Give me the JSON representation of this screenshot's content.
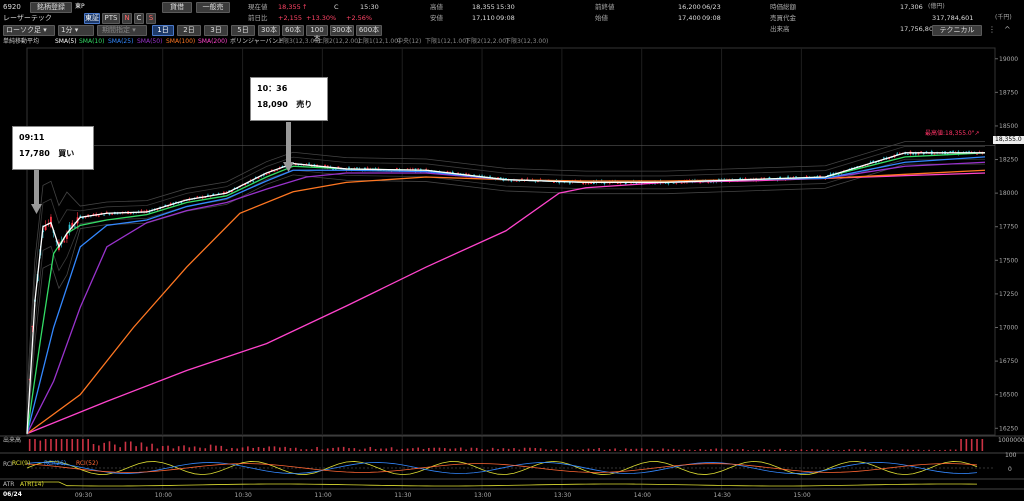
{
  "header": {
    "code": "6920",
    "name": "レーザーテック",
    "btn_stock_list": "銘柄登録",
    "tag_exchange": "東P",
    "tag_tse": "東証",
    "tag_pts": "PTS",
    "tag_n": "N",
    "tag_c": "C",
    "tag_s": "S",
    "btn_credit": "貸借",
    "btn_general": "一般売",
    "chart_type": "ローソク足",
    "interval": "1分",
    "period_label": "期間指定",
    "ranges": [
      "1日",
      "2日",
      "3日",
      "5日",
      "30本",
      "60本",
      "100本",
      "300本",
      "600本"
    ],
    "active_range": 0,
    "technical_btn": "テクニカル",
    "quote": {
      "price_label": "現在値",
      "price": "18,355",
      "price_mark": "↑",
      "c": "C",
      "time": "15:30",
      "change_label": "前日比",
      "change": "+2,155",
      "change_pct": "+13.30%",
      "change_pct2": "+2.56%",
      "high_label": "高値",
      "high": "18,355",
      "high_time": "15:30",
      "low_label": "安値",
      "low": "17,110",
      "low_time": "09:08",
      "prev_label": "前終値",
      "prev": "16,200",
      "prev_date": "06/23",
      "open_label": "始値",
      "open": "17,400",
      "open_time": "09:08",
      "mcap_label": "時価総額",
      "mcap": "17,306",
      "mcap_unit": "(億円)",
      "turnover_label": "売買代金",
      "turnover": "317,784,601",
      "turnover_unit": "(千円)",
      "volume_label": "出来高",
      "volume": "17,756,800"
    },
    "legend": [
      {
        "text": "単純移動平均",
        "color": "#cccccc"
      },
      {
        "text": "SMA(5)",
        "color": "#ffffff"
      },
      {
        "text": "SMA(10)",
        "color": "#33dd66"
      },
      {
        "text": "SMA(25)",
        "color": "#3388ff"
      },
      {
        "text": "SMA(50)",
        "color": "#9933cc"
      },
      {
        "text": "SMA(100)",
        "color": "#ff7722"
      },
      {
        "text": "SMA(200)",
        "color": "#ff44cc"
      },
      {
        "text": "ボリンジャーバンド",
        "color": "#cccccc"
      },
      {
        "text": "上限3(12,3.00)",
        "color": "#888888"
      },
      {
        "text": "上限2(12,2.00)",
        "color": "#888888"
      },
      {
        "text": "上限1(12,1.00)",
        "color": "#888888"
      },
      {
        "text": "中央(12)",
        "color": "#888888"
      },
      {
        "text": "下限1(12,1.00)",
        "color": "#888888"
      },
      {
        "text": "下限2(12,2.00)",
        "color": "#888888"
      },
      {
        "text": "下限3(12,3.00)",
        "color": "#888888"
      }
    ]
  },
  "callouts": {
    "buy": {
      "time": "09:11",
      "price": "17,780",
      "action": "買い"
    },
    "sell": {
      "time": "10：36",
      "price": "18,090",
      "action": "売り"
    }
  },
  "annotations": {
    "high_label": "最高値:18,355.0\"↗",
    "last_price": "18,355.0"
  },
  "volume_panel": {
    "label": "出来高",
    "scale": "1000000"
  },
  "rci_panel": {
    "label": "RCI",
    "legend": [
      "RCI(9)",
      "RCI(26)",
      "RCI(52)"
    ],
    "colors": [
      "#dddd33",
      "#3388ff",
      "#ff6633"
    ],
    "scale_top": "100",
    "scale_mid": "0"
  },
  "atr_panel": {
    "label": "ATR",
    "legend": "ATR(14)",
    "color": "#dddd33"
  },
  "chart_data": {
    "type": "line",
    "y_ticks": [
      19000,
      18750,
      18500,
      18250,
      18000,
      17750,
      17500,
      17250,
      17000,
      16750,
      16500,
      16250
    ],
    "ylim": [
      16200,
      19080
    ],
    "x_date": "06/24",
    "x_ticks": [
      "09:30",
      "10:00",
      "10:30",
      "11:00",
      "11:30",
      "13:00",
      "13:30",
      "14:00",
      "14:30",
      "15:00"
    ],
    "series": [
      {
        "name": "SMA(5)",
        "color": "#ffffff",
        "x": [
          0,
          3,
          6,
          9,
          12,
          15,
          20,
          30,
          45,
          60,
          75,
          90,
          100,
          120,
          150,
          180,
          210,
          240,
          270,
          300,
          330,
          360
        ],
        "y": [
          16210,
          17200,
          17750,
          17780,
          17600,
          17700,
          17820,
          17850,
          17860,
          17950,
          18000,
          18150,
          18220,
          18180,
          18170,
          18100,
          18080,
          18080,
          18100,
          18120,
          18300,
          18300
        ]
      },
      {
        "name": "SMA(10)",
        "color": "#33dd66",
        "x": [
          0,
          5,
          10,
          15,
          20,
          30,
          45,
          60,
          75,
          90,
          100,
          120,
          150,
          180,
          210,
          240,
          270,
          300,
          330,
          360
        ],
        "y": [
          16210,
          16900,
          17550,
          17700,
          17760,
          17800,
          17840,
          17930,
          17980,
          18120,
          18200,
          18180,
          18170,
          18100,
          18080,
          18080,
          18100,
          18120,
          18270,
          18300
        ]
      },
      {
        "name": "SMA(25)",
        "color": "#3388ff",
        "x": [
          0,
          10,
          20,
          30,
          45,
          60,
          75,
          90,
          100,
          120,
          150,
          180,
          210,
          240,
          270,
          300,
          330,
          360
        ],
        "y": [
          16210,
          17000,
          17600,
          17760,
          17800,
          17900,
          17960,
          18090,
          18170,
          18170,
          18160,
          18100,
          18080,
          18080,
          18100,
          18110,
          18230,
          18270
        ]
      },
      {
        "name": "SMA(50)",
        "color": "#9933cc",
        "x": [
          0,
          10,
          20,
          30,
          45,
          60,
          75,
          90,
          105,
          120,
          150,
          180,
          210,
          240,
          270,
          300,
          330,
          360
        ],
        "y": [
          16210,
          16600,
          17150,
          17600,
          17780,
          17870,
          17930,
          18030,
          18120,
          18150,
          18150,
          18100,
          18080,
          18080,
          18100,
          18110,
          18200,
          18230
        ]
      },
      {
        "name": "SMA(100)",
        "color": "#ff7722",
        "x": [
          0,
          20,
          40,
          60,
          80,
          100,
          120,
          150,
          180,
          210,
          240,
          270,
          300,
          330,
          360
        ],
        "y": [
          16210,
          16500,
          17000,
          17450,
          17850,
          18010,
          18080,
          18120,
          18100,
          18090,
          18090,
          18100,
          18110,
          18140,
          18170
        ]
      },
      {
        "name": "SMA(200)",
        "color": "#ff44cc",
        "x": [
          0,
          30,
          60,
          90,
          120,
          150,
          180,
          200,
          210,
          240,
          270,
          300,
          330,
          360
        ],
        "y": [
          16210,
          16450,
          16680,
          16880,
          17160,
          17450,
          17720,
          18000,
          18040,
          18080,
          18090,
          18110,
          18130,
          18150
        ]
      }
    ],
    "volume": [
      320000,
      110000,
      80000,
      60000,
      50000,
      45000,
      40000,
      38000,
      35000,
      30000,
      28000,
      25000,
      22000,
      20000,
      18000,
      200000
    ],
    "last_price": 18355
  }
}
